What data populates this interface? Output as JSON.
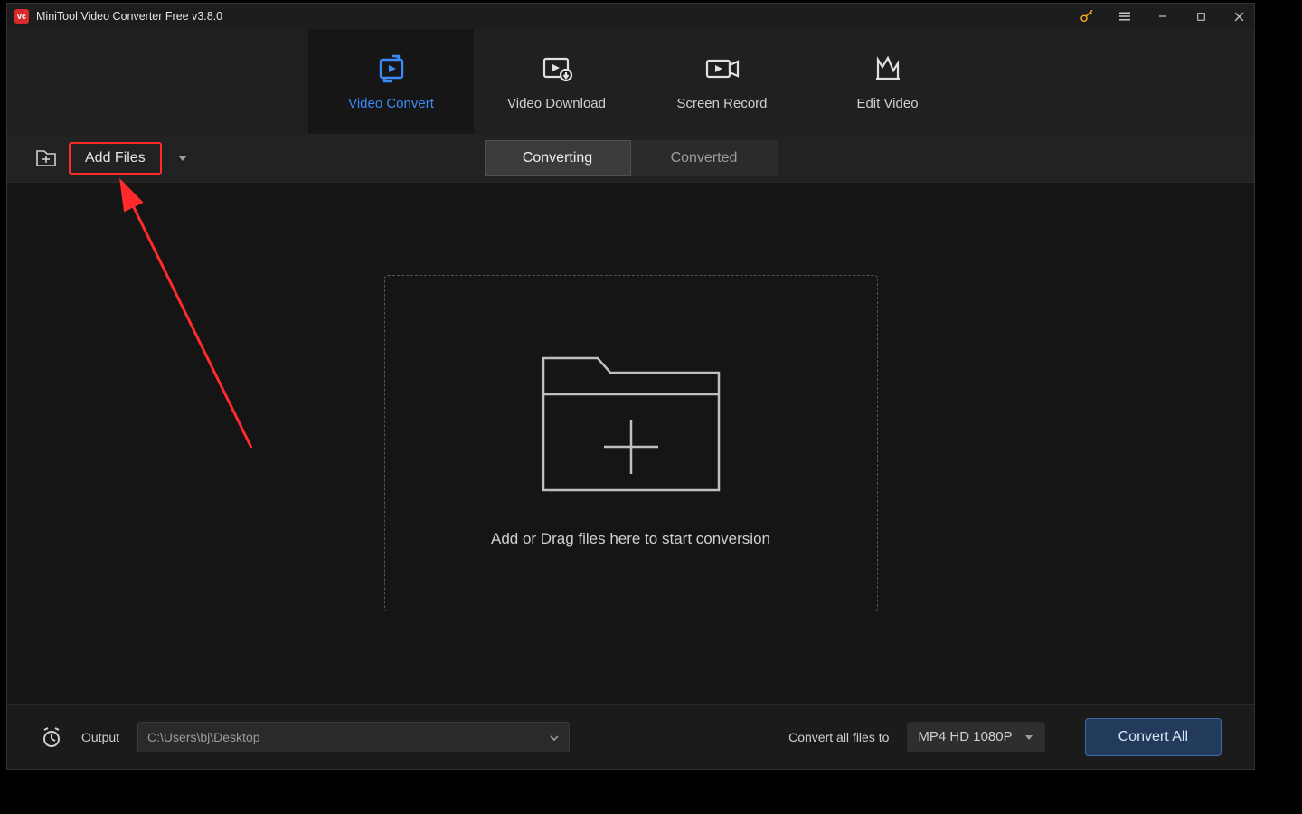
{
  "titlebar": {
    "app_title": "MiniTool Video Converter Free v3.8.0"
  },
  "main_tabs": [
    {
      "label": "Video Convert",
      "active": true
    },
    {
      "label": "Video Download",
      "active": false
    },
    {
      "label": "Screen Record",
      "active": false
    },
    {
      "label": "Edit Video",
      "active": false
    }
  ],
  "add_files": {
    "label": "Add Files"
  },
  "conv_segments": [
    {
      "label": "Converting",
      "active": true
    },
    {
      "label": "Converted",
      "active": false
    }
  ],
  "dropzone": {
    "text": "Add or Drag files here to start conversion"
  },
  "footer": {
    "output_label": "Output",
    "output_path": "C:\\Users\\bj\\Desktop",
    "convert_all_label": "Convert all files to",
    "format_selected": "MP4 HD 1080P",
    "convert_all_button": "Convert All"
  },
  "colors": {
    "accent_blue": "#3b8af5",
    "annotation_red": "#ff2b2b"
  }
}
